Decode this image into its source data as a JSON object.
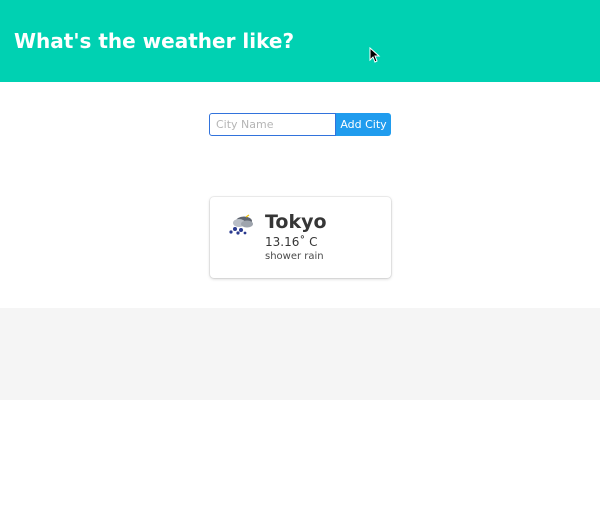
{
  "header": {
    "title": "What's the weather like?",
    "background_color": "#00d1b2"
  },
  "search": {
    "placeholder": "City Name",
    "value": "",
    "button_label": "Add City",
    "button_color": "#209cee"
  },
  "cities": [
    {
      "name": "Tokyo",
      "temperature": "13.16˚ C",
      "description": "shower rain",
      "icon": "shower-rain-icon"
    }
  ],
  "footer": {
    "background_color": "#f5f5f5"
  }
}
